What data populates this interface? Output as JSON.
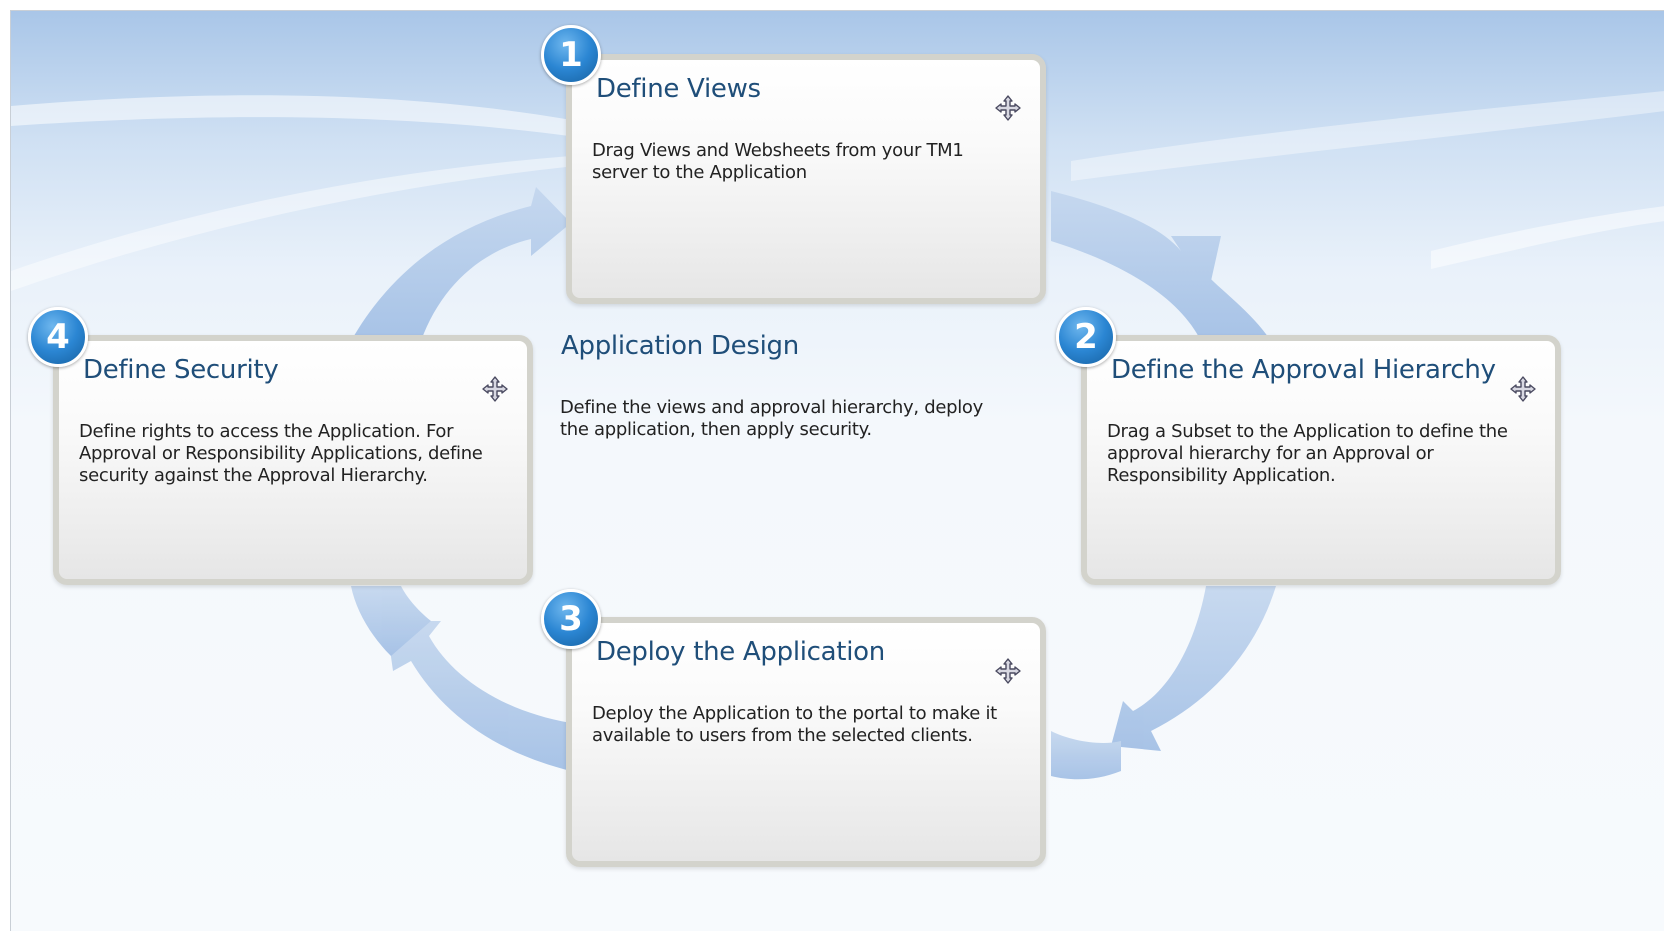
{
  "center": {
    "title": "Application Design",
    "description": "Define the views and approval hierarchy, deploy the application, then apply security."
  },
  "steps": [
    {
      "number": "1",
      "title": "Define Views",
      "description": "Drag Views and Websheets from your TM1 server to the Application",
      "icon": "move-icon"
    },
    {
      "number": "2",
      "title": "Define the Approval Hierarchy",
      "description": "Drag a Subset to the Application to define the approval hierarchy for an Approval or Responsibility Application.",
      "icon": "move-icon"
    },
    {
      "number": "3",
      "title": "Deploy the Application",
      "description": "Deploy the Application to the portal to make it available to users from the selected clients.",
      "icon": "move-icon"
    },
    {
      "number": "4",
      "title": "Define Security",
      "description": "Define rights to access the Application. For Approval or Responsibility Applications, define security against the Approval Hierarchy.",
      "icon": "move-icon"
    }
  ],
  "colors": {
    "title": "#1f4e79",
    "badge": "#2b86d3",
    "arrow": "#a9c4e6",
    "card_border": "#d3d3cc"
  }
}
